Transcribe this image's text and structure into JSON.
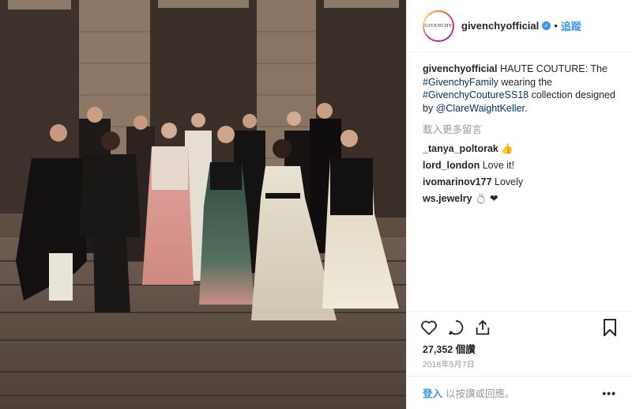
{
  "post": {
    "photo_alt": "HAUTE COUTURE group photo",
    "account": {
      "avatar_text": "GIVENCHY",
      "username": "givenchyofficial",
      "separator": "•",
      "follow_label": "追蹤"
    },
    "caption": {
      "username": "givenchyofficial",
      "text_1": " HAUTE COUTURE: The ",
      "hashtag_1": "#GivenchyFamily",
      "text_2": " wearing the ",
      "hashtag_2": "#GivenchyCoutureSS18",
      "text_3": " collection designed by ",
      "mention": "@ClareWaightKeller",
      "text_4": "."
    },
    "load_more_label": "載入更多留言",
    "comments": [
      {
        "user": "_tanya_poltorak",
        "text": " 👍"
      },
      {
        "user": "lord_london",
        "text": " Love it!"
      },
      {
        "user": "ivomarinov177",
        "text": " Lovely"
      },
      {
        "user": "ws.jewelry",
        "text": " 💍 ❤"
      }
    ],
    "likes": "27,352 個讚",
    "date": "2018年5月7日",
    "footer": {
      "login_label": "登入",
      "prompt": "以按讚或回應。",
      "more_label": "•••"
    }
  },
  "colors": {
    "link_blue": "#3897f0",
    "text": "#262626",
    "muted": "#999999"
  },
  "icons": {
    "like": "heart-icon",
    "comment": "comment-icon",
    "share": "share-icon",
    "save": "bookmark-icon"
  }
}
